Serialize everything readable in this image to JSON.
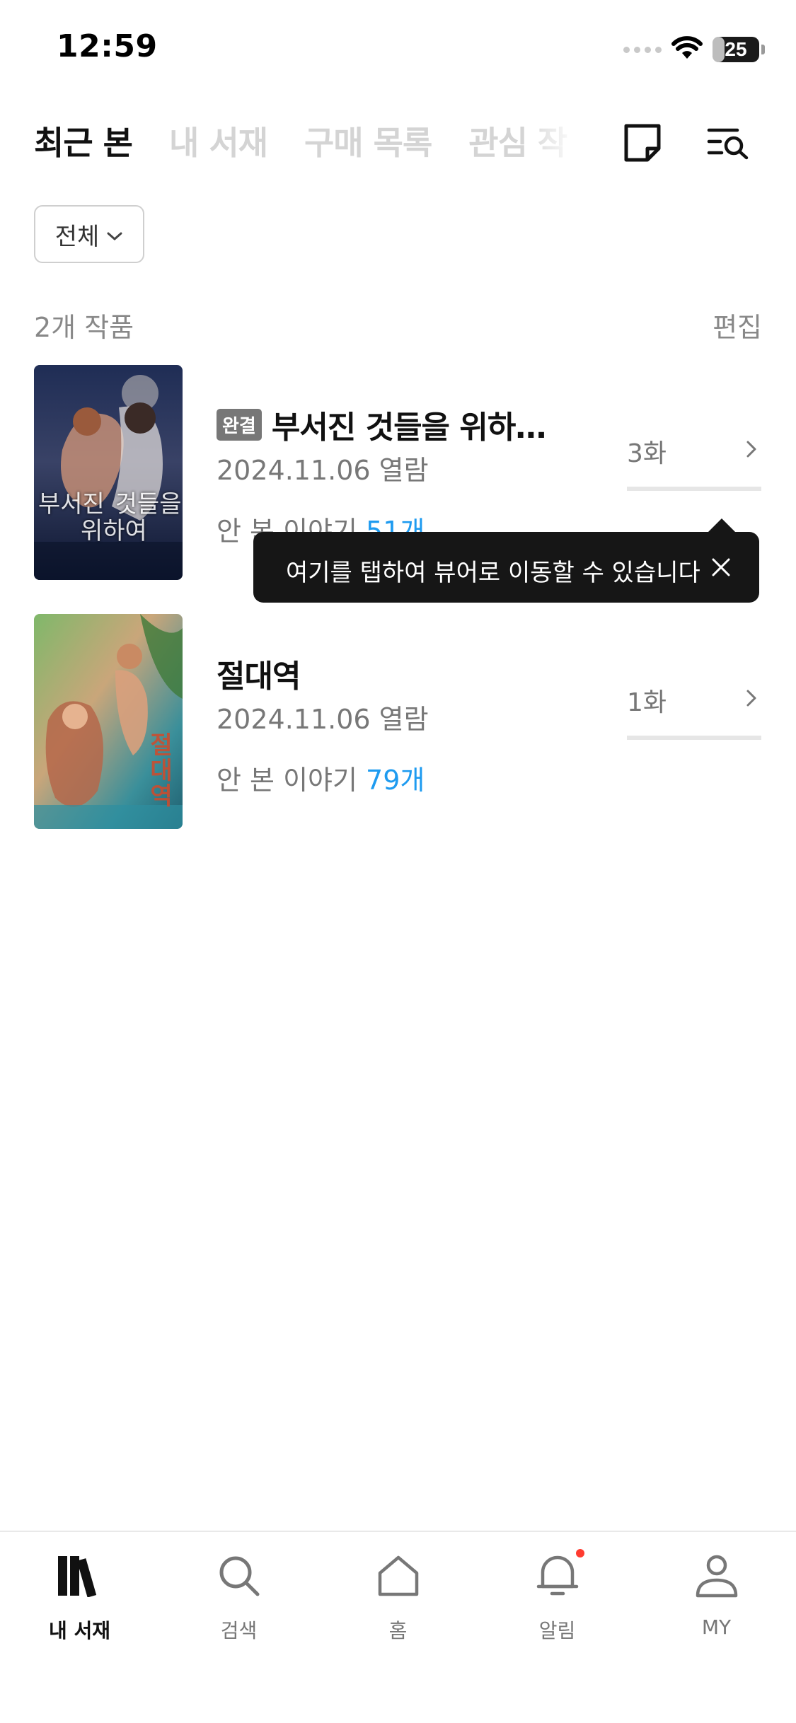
{
  "status_bar": {
    "time": "12:59",
    "battery": "25",
    "battery_level": 0.25
  },
  "tabs": [
    {
      "label": "최근 본",
      "active": true
    },
    {
      "label": "내 서재",
      "active": false
    },
    {
      "label": "구매 목록",
      "active": false
    },
    {
      "label": "관심 작",
      "active": false
    }
  ],
  "header_icons": [
    "memo-icon",
    "search-list-icon"
  ],
  "filter": {
    "label": "전체"
  },
  "summary": {
    "count_label": "2개 작품",
    "edit_label": "편집"
  },
  "items": [
    {
      "badge": "완결",
      "title": "부서진 것들을 위하…",
      "date": "2024.11.06 열람",
      "unread_prefix": "안 본 이야기 ",
      "unread_count": "51개",
      "episode": "3화",
      "cover_text": [
        "부서진",
        "것들을",
        "위하여"
      ]
    },
    {
      "badge": "",
      "title": "절대역",
      "date": "2024.11.06 열람",
      "unread_prefix": "안 본 이야기 ",
      "unread_count": "79개",
      "episode": "1화",
      "cover_text": [
        "절대역"
      ]
    }
  ],
  "tooltip": {
    "text": "여기를 탭하여 뷰어로 이동할 수 있습니다"
  },
  "bottom_nav": [
    {
      "label": "내 서재",
      "icon": "library-icon",
      "active": true
    },
    {
      "label": "검색",
      "icon": "search-icon",
      "active": false
    },
    {
      "label": "홈",
      "icon": "home-icon",
      "active": false
    },
    {
      "label": "알림",
      "icon": "bell-icon",
      "active": false,
      "has_dot": true
    },
    {
      "label": "MY",
      "icon": "person-icon",
      "active": false
    }
  ],
  "colors": {
    "accent": "#1e9bf0",
    "notification_dot": "#ff3b30",
    "tooltip_bg": "#161616"
  }
}
